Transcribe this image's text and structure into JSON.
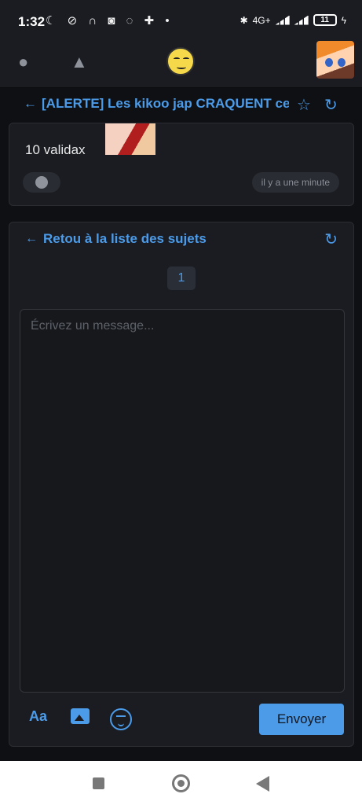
{
  "status": {
    "time": "1:32",
    "left_icons": "☾ ⊘ ∩ ◙ ◌ ✚ •",
    "network": "4G+",
    "battery": "11"
  },
  "topbar": {
    "idea_icon": "lightbulb-icon",
    "bell_icon": "bell-icon"
  },
  "thread": {
    "title": "[ALERTE] Les kikoo jap CRAQUENT ce"
  },
  "message": {
    "text": "10 validax",
    "time": "il y a une minute"
  },
  "compose": {
    "back_label": "Retou à la liste des sujets",
    "page": "1",
    "placeholder": "Écrivez un message...",
    "format_label": "Aa",
    "send_label": "Envoyer"
  },
  "colors": {
    "accent": "#4b9be8",
    "background": "#0f1013",
    "card": "#1b1c21"
  }
}
